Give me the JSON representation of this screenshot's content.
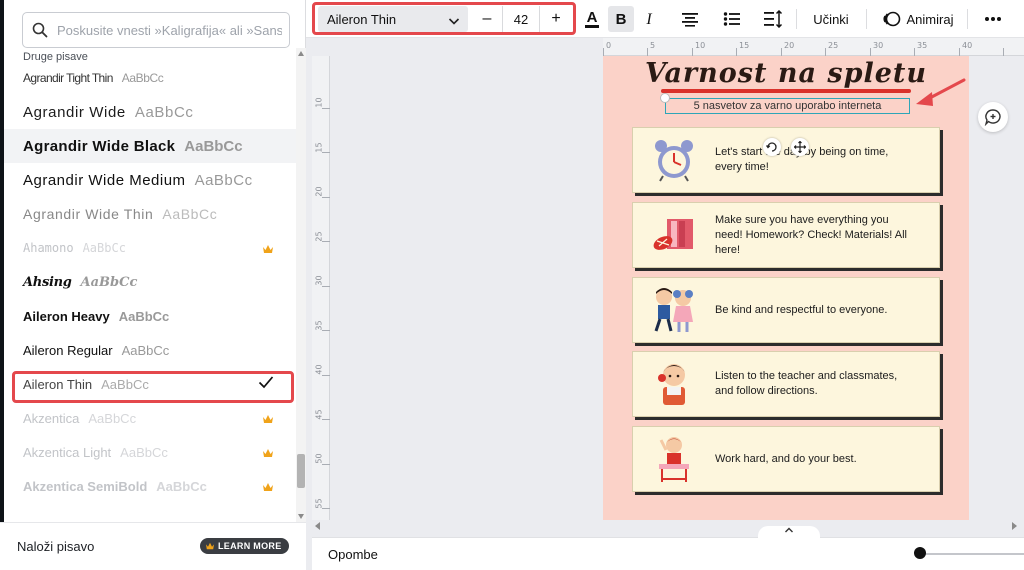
{
  "font_panel": {
    "search_placeholder": "Poskusite vnesti »Kaligrafija« ali »Sans",
    "section_label": "Druge pisave",
    "fonts": [
      {
        "name": "Agrandir Tight Thin",
        "sample": "AaBbCc",
        "premium": false,
        "selected": false
      },
      {
        "name": "Agrandir Wide",
        "sample": "AaBbCc",
        "premium": false,
        "selected": false
      },
      {
        "name": "Agrandir Wide Black",
        "sample": "AaBbCc",
        "premium": false,
        "selected": false
      },
      {
        "name": "Agrandir Wide Medium",
        "sample": "AaBbCc",
        "premium": false,
        "selected": false
      },
      {
        "name": "Agrandir Wide Thin",
        "sample": "AaBbCc",
        "premium": false,
        "selected": false
      },
      {
        "name": "Ahamono",
        "sample": "AaBbCc",
        "premium": true,
        "selected": false
      },
      {
        "name": "Ahsing",
        "sample": "AaBbCc",
        "premium": false,
        "selected": false
      },
      {
        "name": "Aileron Heavy",
        "sample": "AaBbCc",
        "premium": false,
        "selected": false
      },
      {
        "name": "Aileron Regular",
        "sample": "AaBbCc",
        "premium": false,
        "selected": false
      },
      {
        "name": "Aileron Thin",
        "sample": "AaBbCc",
        "premium": false,
        "selected": true
      },
      {
        "name": "Akzentica",
        "sample": "AaBbCc",
        "premium": true,
        "selected": false
      },
      {
        "name": "Akzentica Light",
        "sample": "AaBbCc",
        "premium": true,
        "selected": false
      },
      {
        "name": "Akzentica SemiBold",
        "sample": "AaBbCc",
        "premium": true,
        "selected": false
      }
    ],
    "footer": {
      "upload_label": "Naloži pisavo",
      "learn_more_label": "LEARN MORE"
    }
  },
  "toolbar": {
    "font_name": "Aileron Thin",
    "font_size": "42",
    "minus_label": "–",
    "plus_label": "+",
    "effects_label": "Učinki",
    "animate_label": "Animiraj"
  },
  "rulers": {
    "top": [
      "0",
      "5",
      "10",
      "15",
      "20",
      "25",
      "30",
      "35",
      "40"
    ],
    "left": [
      "10",
      "15",
      "20",
      "25",
      "30",
      "35",
      "40",
      "45",
      "50",
      "55"
    ]
  },
  "page": {
    "title": "Varnost na spletu",
    "subtitle": "5 nasvetov za varno uporabo interneta",
    "tips": [
      {
        "icon": "alarm-clock-illustration",
        "text": "Let's start the day by being on time, every time!"
      },
      {
        "icon": "books-illustration",
        "text": "Make sure you have everything you need! Homework? Check! Materials! All here!"
      },
      {
        "icon": "kids-illustration",
        "text": "Be kind and respectful to everyone."
      },
      {
        "icon": "listening-child-illustration",
        "text": "Listen to the teacher and classmates, and follow directions."
      },
      {
        "icon": "student-desk-illustration",
        "text": "Work hard, and do your best."
      }
    ]
  },
  "bottom_bar": {
    "notes_label": "Opombe"
  },
  "colors": {
    "highlight_red": "#e4484c",
    "page_background": "#fbd2c8",
    "card_background": "#fdf6dd",
    "crown_gold": "#f0a31a"
  }
}
